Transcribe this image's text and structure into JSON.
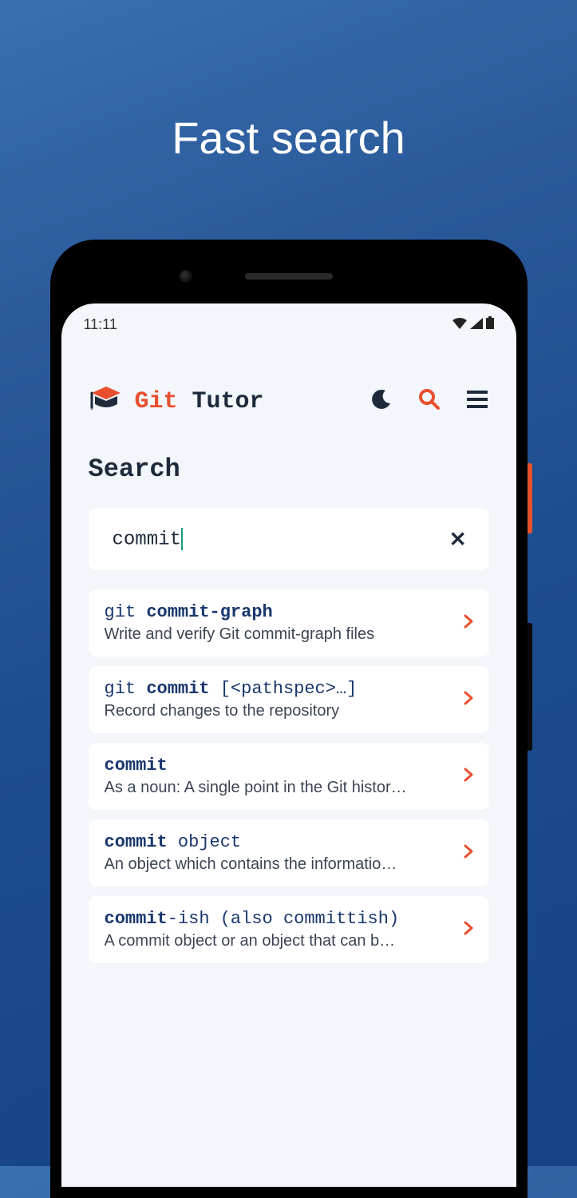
{
  "hero": {
    "title": "Fast search"
  },
  "statusbar": {
    "time": "11:11"
  },
  "header": {
    "brand_git": "Git",
    "brand_tutor": "Tutor"
  },
  "search": {
    "section_title": "Search",
    "input_value": "commit",
    "clear_label": "✕"
  },
  "results": [
    {
      "prefix": "git ",
      "bold": "commit-graph",
      "suffix": "",
      "desc": "Write and verify Git commit-graph files"
    },
    {
      "prefix": "git ",
      "bold": "commit",
      "suffix": " [<pathspec>…]",
      "desc": "Record changes to the repository"
    },
    {
      "prefix": "",
      "bold": "commit",
      "suffix": "",
      "desc": "As a noun: A single point in the Git histor…"
    },
    {
      "prefix": "",
      "bold": "commit",
      "suffix": " object",
      "desc": "An object which contains the informatio…"
    },
    {
      "prefix": "",
      "bold": "commit",
      "suffix": "-ish (also committish)",
      "desc": "A commit object or an object that can b…"
    }
  ]
}
